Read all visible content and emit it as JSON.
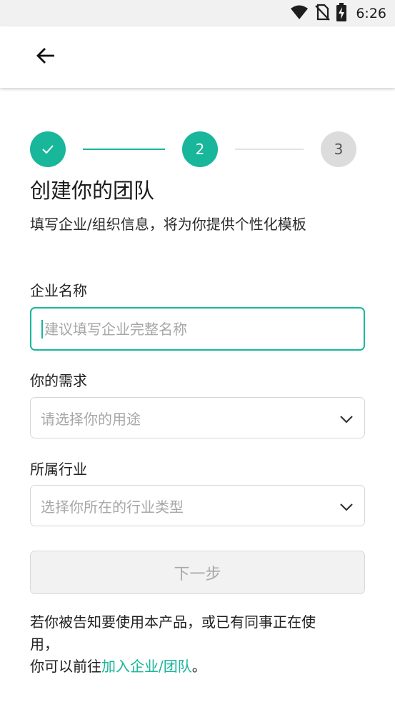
{
  "status_bar": {
    "time": "6:26",
    "icons": [
      "wifi-icon",
      "no-sim-icon",
      "battery-charging-icon"
    ]
  },
  "app_bar": {
    "back_icon": "arrow-left-icon"
  },
  "stepper": {
    "steps": [
      {
        "label": "✓",
        "state": "done"
      },
      {
        "label": "2",
        "state": "active"
      },
      {
        "label": "3",
        "state": "todo"
      }
    ],
    "colors": {
      "active": "#18b69a",
      "inactive": "#dcdcdc"
    }
  },
  "page": {
    "title": "创建你的团队",
    "subtitle": "填写企业/组织信息，将为你提供个性化模板"
  },
  "form": {
    "company_name": {
      "label": "企业名称",
      "placeholder": "建议填写企业完整名称",
      "value": ""
    },
    "needs": {
      "label": "你的需求",
      "placeholder": "请选择你的用途"
    },
    "industry": {
      "label": "所属行业",
      "placeholder": "选择你所在的行业类型"
    },
    "next_button": "下一步"
  },
  "footer": {
    "text_line1": "若你被告知要使用本产品，或已有同事正在使",
    "text_line2": "用，",
    "text_prefix": "你可以前往",
    "link": "加入企业/团队",
    "text_suffix": "。"
  },
  "colors": {
    "accent": "#18b69a",
    "disabled_bg": "#f2f2f2",
    "disabled_text": "#a8a8a8"
  }
}
